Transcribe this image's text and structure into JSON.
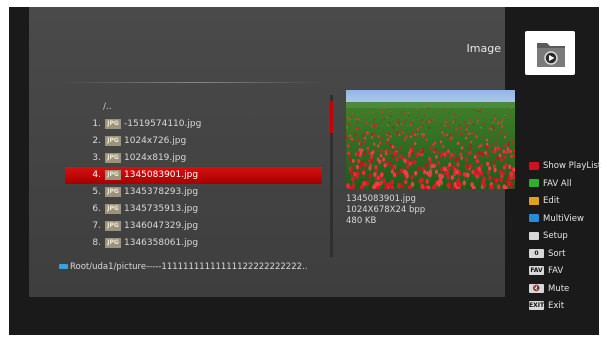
{
  "header": {
    "title": "Image",
    "icon": "folder-play-icon"
  },
  "file_list": {
    "parent": "/..",
    "items": [
      {
        "num": "1.",
        "badge": "JPG",
        "name": "-1519574110.jpg"
      },
      {
        "num": "2.",
        "badge": "JPG",
        "name": "1024x726.jpg"
      },
      {
        "num": "3.",
        "badge": "JPG",
        "name": "1024x819.jpg"
      },
      {
        "num": "4.",
        "badge": "JPG",
        "name": "1345083901.jpg",
        "selected": true
      },
      {
        "num": "5.",
        "badge": "JPG",
        "name": "1345378293.jpg"
      },
      {
        "num": "6.",
        "badge": "JPG",
        "name": "1345735913.jpg"
      },
      {
        "num": "7.",
        "badge": "JPG",
        "name": "1346047329.jpg"
      },
      {
        "num": "8.",
        "badge": "JPG",
        "name": "1346358061.jpg"
      }
    ]
  },
  "path": "Root/uda1/picture-----11111111111111122222222222..",
  "preview": {
    "filename": "1345083901.jpg",
    "dimensions": "1024X678X24 bpp",
    "size": "480 KB"
  },
  "side_menu": [
    {
      "label": "Show PlayList",
      "swatch": "#d0101a"
    },
    {
      "label": "FAV All",
      "swatch": "#2fae2f"
    },
    {
      "label": "Edit",
      "swatch": "#e0a020"
    },
    {
      "label": "MultiView",
      "swatch": "#2a8ad8"
    },
    {
      "label": "Setup",
      "swatch": "#d8d8d8"
    },
    {
      "label": "Sort",
      "key": "0"
    },
    {
      "label": "FAV",
      "key": "FAV"
    },
    {
      "label": "Mute",
      "key": "🔇"
    },
    {
      "label": "Exit",
      "key": "EXIT"
    }
  ]
}
